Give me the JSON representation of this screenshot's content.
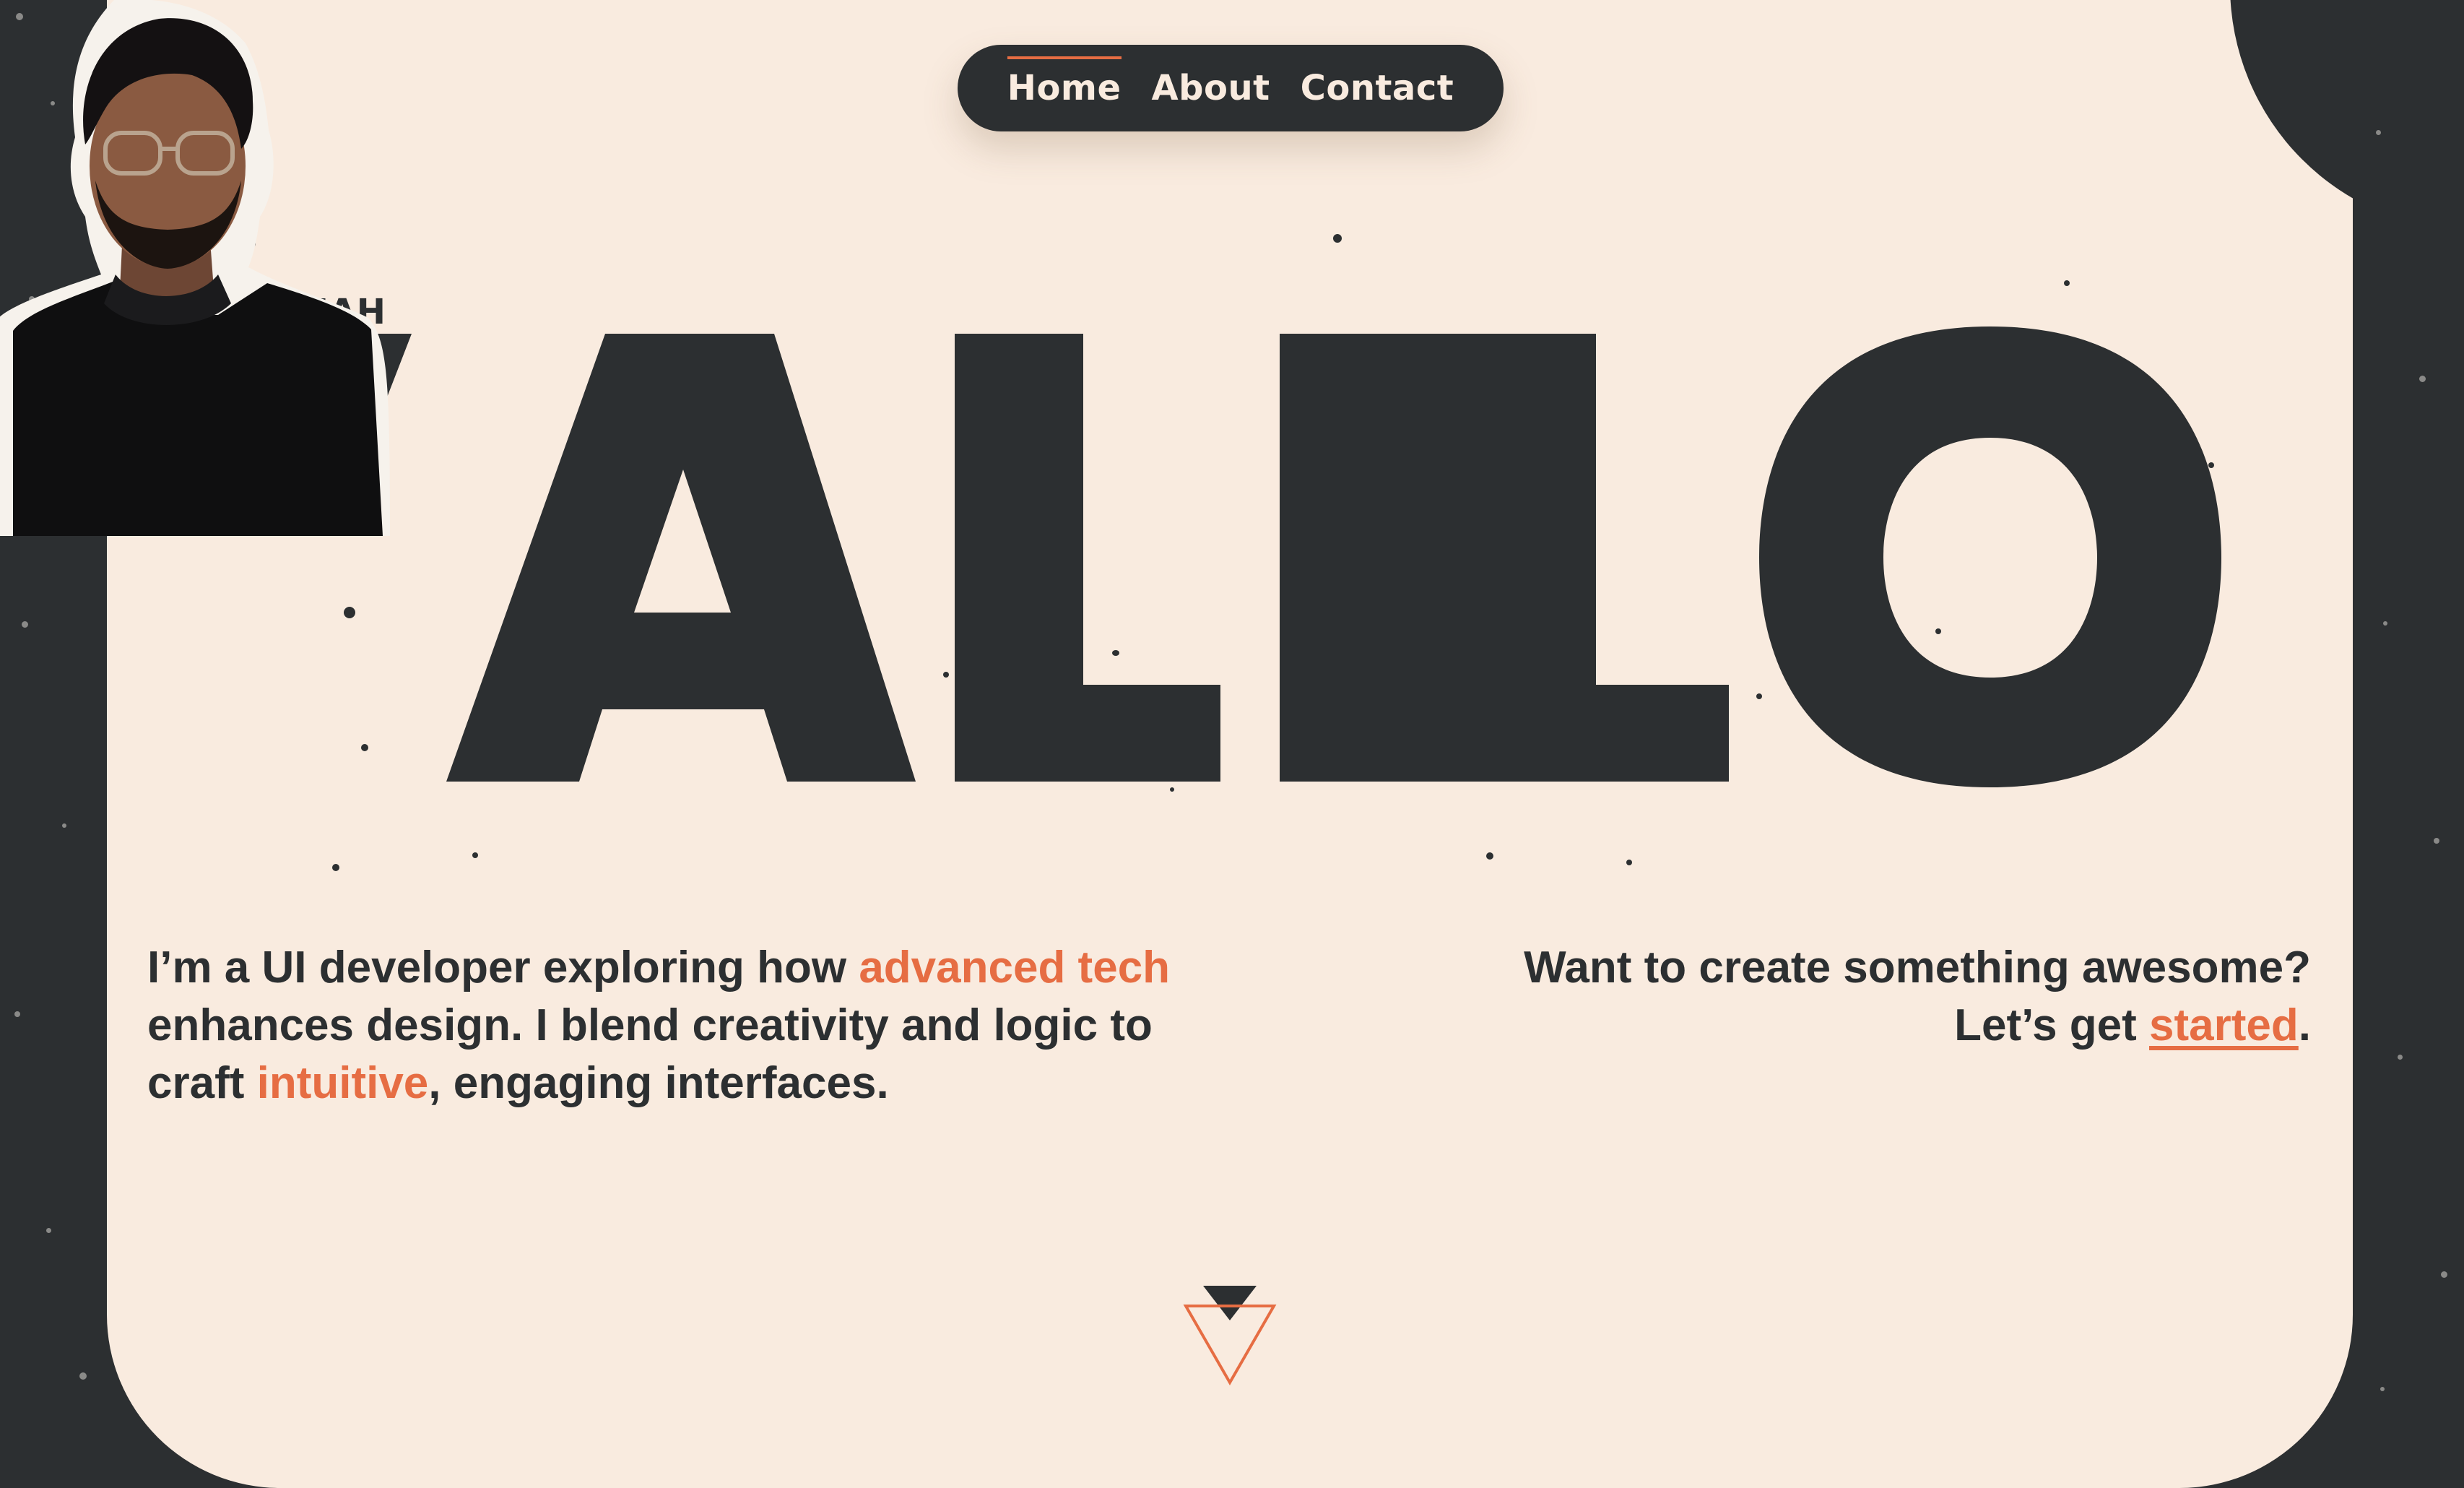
{
  "nav": {
    "items": [
      {
        "label": "Home",
        "active": true
      },
      {
        "label": "About",
        "active": false
      },
      {
        "label": "Contact",
        "active": false
      }
    ]
  },
  "hero": {
    "kicker": "YEAH",
    "headline": "'ALLO",
    "photo_alt": "portrait-photo"
  },
  "intro": {
    "part1": "I’m a UI developer exploring how ",
    "highlight1": "advanced tech",
    "part2": " enhances design. I blend creativity and logic to craft ",
    "highlight2": "intuitive",
    "part3": ", engaging interfaces."
  },
  "cta": {
    "line1": "Want to create something awesome?",
    "line2_prefix": "Let’s get ",
    "link": "started",
    "line2_suffix": "."
  },
  "colors": {
    "dark": "#2c2f31",
    "cream": "#f9ebdf",
    "accent": "#e66d43"
  },
  "icons": {
    "scroll": "scroll-down-triangle-icon"
  }
}
